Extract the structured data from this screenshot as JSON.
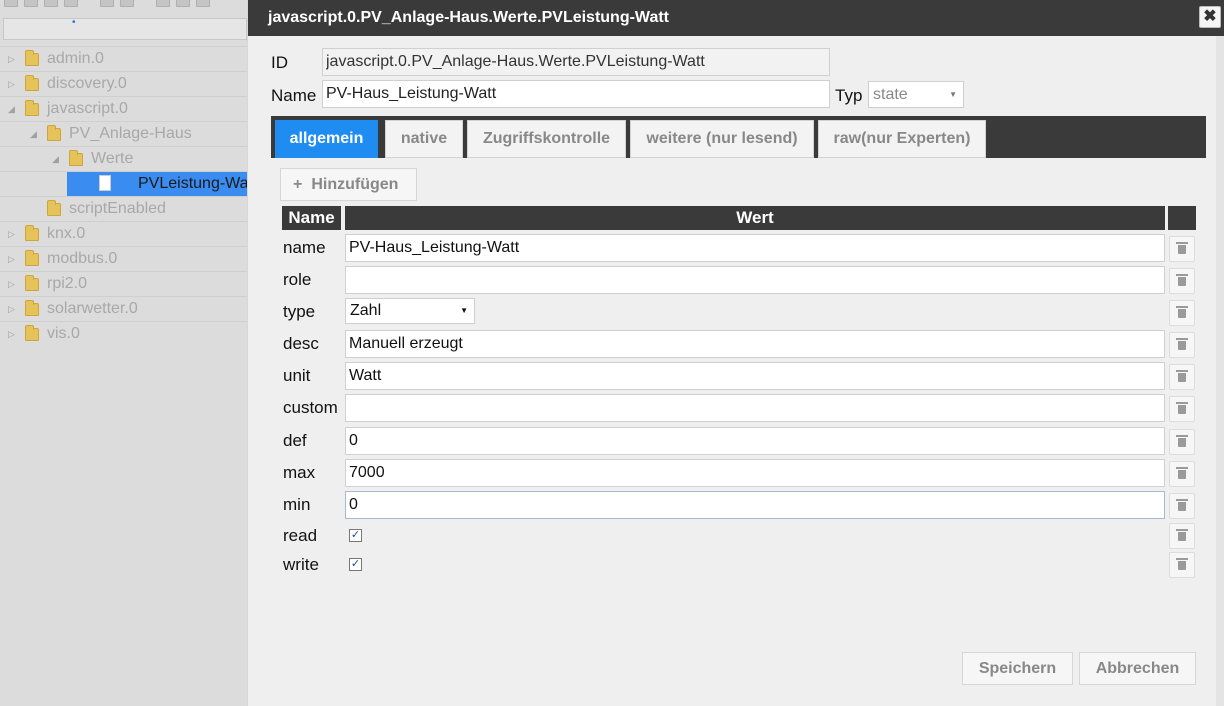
{
  "sidebar": {
    "toolbar_icons": [
      "refresh-icon",
      "grid-icon",
      "folder-icon",
      "folder-open-icon",
      "download-icon",
      "upload-icon",
      "add-icon",
      "move-up-icon",
      "move-down-icon"
    ],
    "tree": [
      {
        "label": "admin.0",
        "type": "folder"
      },
      {
        "label": "discovery.0",
        "type": "folder"
      },
      {
        "label": "javascript.0",
        "type": "folder",
        "expanded": true
      },
      {
        "label": "PV_Anlage-Haus",
        "type": "folder",
        "expanded": true
      },
      {
        "label": "Werte",
        "type": "folder",
        "expanded": true
      },
      {
        "label": "PVLeistung-Watt",
        "type": "file",
        "selected": true
      },
      {
        "label": "scriptEnabled",
        "type": "folder"
      },
      {
        "label": "knx.0",
        "type": "folder"
      },
      {
        "label": "modbus.0",
        "type": "folder"
      },
      {
        "label": "rpi2.0",
        "type": "folder"
      },
      {
        "label": "solarwetter.0",
        "type": "folder"
      },
      {
        "label": "vis.0",
        "type": "folder"
      }
    ]
  },
  "dialog": {
    "title": "javascript.0.PV_Anlage-Haus.Werte.PVLeistung-Watt",
    "close_symbol": "✖",
    "id_label": "ID",
    "id_value": "javascript.0.PV_Anlage-Haus.Werte.PVLeistung-Watt",
    "name_label": "Name",
    "name_value": "PV-Haus_Leistung-Watt",
    "typ_label": "Typ",
    "typ_value": "state",
    "tabs": [
      {
        "label": "allgemein",
        "active": true
      },
      {
        "label": "native"
      },
      {
        "label": "Zugriffskontrolle"
      },
      {
        "label": "weitere (nur lesend)"
      },
      {
        "label": "raw(nur Experten)"
      }
    ],
    "add_label": "Hinzufügen",
    "add_symbol": "+",
    "table_headers": {
      "name": "Name",
      "value": "Wert"
    },
    "properties": [
      {
        "name": "name",
        "value": "PV-Haus_Leistung-Watt",
        "kind": "text"
      },
      {
        "name": "role",
        "value": "",
        "kind": "text"
      },
      {
        "name": "type",
        "value": "Zahl",
        "kind": "select"
      },
      {
        "name": "desc",
        "value": "Manuell erzeugt",
        "kind": "text"
      },
      {
        "name": "unit",
        "value": "Watt",
        "kind": "text"
      },
      {
        "name": "custom",
        "value": "",
        "kind": "text"
      },
      {
        "name": "def",
        "value": "0",
        "kind": "text"
      },
      {
        "name": "max",
        "value": "7000",
        "kind": "text"
      },
      {
        "name": "min",
        "value": "0",
        "kind": "text",
        "focused": true
      },
      {
        "name": "read",
        "value": true,
        "kind": "checkbox"
      },
      {
        "name": "write",
        "value": true,
        "kind": "checkbox"
      }
    ],
    "save_label": "Speichern",
    "cancel_label": "Abbrechen"
  },
  "colors": {
    "titlebar": "#3a3a3a",
    "active_tab": "#1f8cf2",
    "selected_tree_item": "#3b8cf0",
    "folder": "#e6c25a"
  }
}
